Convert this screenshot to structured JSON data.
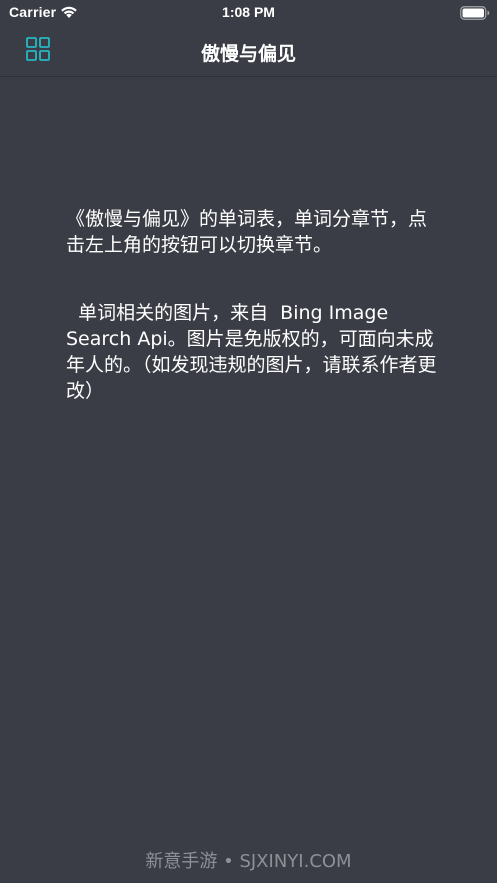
{
  "status_bar": {
    "carrier": "Carrier",
    "time": "1:08 PM"
  },
  "nav": {
    "title": "傲慢与偏见",
    "menu_icon": "grid-icon",
    "accent_color": "#25b8c4"
  },
  "content": {
    "paragraph_1": "《傲慢与偏见》的单词表，单词分章节，点击左上角的按钮可以切换章节。",
    "paragraph_2": "  单词相关的图片，来自  Bing Image Search Api。图片是免版权的，可面向未成年人的。（如发现违规的图片，请联系作者更改）"
  },
  "watermark": "新意手游 • SJXINYI.COM",
  "colors": {
    "background": "#3a3d45",
    "text": "#ffffff",
    "watermark": "#8d9097"
  }
}
